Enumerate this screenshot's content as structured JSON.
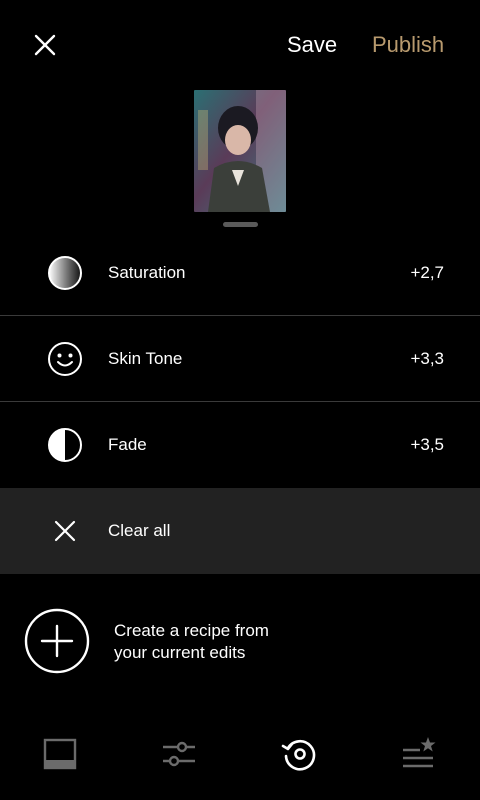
{
  "header": {
    "close_icon": "close-icon",
    "save_label": "Save",
    "publish_label": "Publish",
    "publish_color": "#b89a6e"
  },
  "adjustments": [
    {
      "icon": "saturation-icon",
      "label": "Saturation",
      "value": "+2,7"
    },
    {
      "icon": "skin-tone-icon",
      "label": "Skin Tone",
      "value": "+3,3"
    },
    {
      "icon": "fade-icon",
      "label": "Fade",
      "value": "+3,5"
    }
  ],
  "clear_all": {
    "icon": "close-icon",
    "label": "Clear all"
  },
  "recipe": {
    "icon": "plus-circle-icon",
    "line1": "Create a recipe from",
    "line2": "your current edits"
  },
  "bottom_nav": [
    {
      "icon": "image-icon",
      "active": false
    },
    {
      "icon": "sliders-icon",
      "active": false
    },
    {
      "icon": "history-icon",
      "active": true
    },
    {
      "icon": "recipes-icon",
      "active": false
    }
  ],
  "colors": {
    "background": "#000000",
    "clear_row_bg": "#222222",
    "divider": "#3a3a3a",
    "inactive_nav": "#6b6b6b"
  }
}
